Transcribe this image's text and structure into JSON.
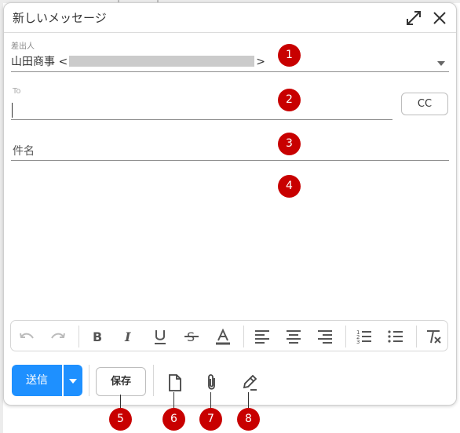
{
  "header": {
    "title": "新しいメッセージ",
    "expand_icon": "expand-arrows-icon",
    "close_icon": "close-x-icon"
  },
  "from": {
    "label": "差出人",
    "name": "山田商事",
    "open_bracket": "<",
    "close_bracket": ">"
  },
  "to": {
    "label": "To",
    "value": ""
  },
  "cc_button": {
    "label": "CC"
  },
  "subject": {
    "placeholder": "件名"
  },
  "toolbar": {
    "buttons": [
      "undo-icon",
      "redo-icon",
      "bold-icon",
      "italic-icon",
      "underline-icon",
      "strikethrough-icon",
      "text-color-icon",
      "align-left-icon",
      "align-center-icon",
      "align-right-icon",
      "numbered-list-icon",
      "bullet-list-icon",
      "clear-formatting-icon"
    ]
  },
  "actions": {
    "send_label": "送信",
    "save_label": "保存",
    "template_icon": "document-icon",
    "attach_icon": "paperclip-icon",
    "signature_icon": "pen-icon"
  },
  "callouts": [
    "1",
    "2",
    "3",
    "4",
    "5",
    "6",
    "7",
    "8"
  ],
  "colors": {
    "accent": "#1e90ff",
    "callout": "#c80000",
    "border": "#cfcfcf"
  }
}
